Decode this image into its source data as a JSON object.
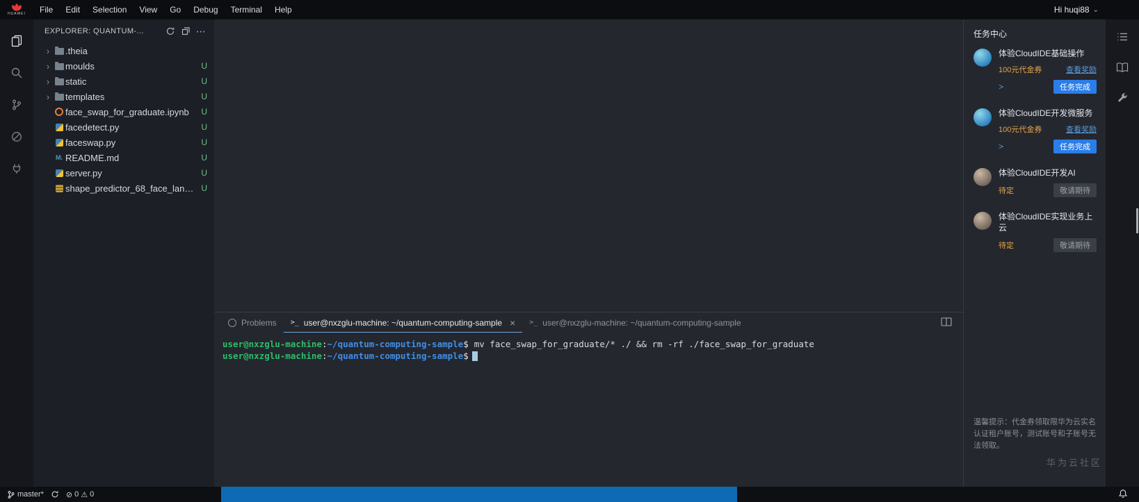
{
  "topbar": {
    "logo_text": "HUAWEI",
    "menus": [
      "File",
      "Edit",
      "Selection",
      "View",
      "Go",
      "Debug",
      "Terminal",
      "Help"
    ],
    "user": "Hi huqi88"
  },
  "icons": {
    "terminal_prompt": ">_",
    "close": "×",
    "more_actions": "⋯",
    "chevron_collapsed": "›",
    "caret_down": "⌄",
    "error_glyph": "⊘",
    "warning_glyph": "⚠",
    "markdown_glyph": "M↓",
    "task_expand": ">"
  },
  "explorer": {
    "title": "EXPLORER: QUANTUM-...",
    "items": [
      {
        "label": ".theia",
        "git": ""
      },
      {
        "label": "moulds",
        "git": "U"
      },
      {
        "label": "static",
        "git": "U"
      },
      {
        "label": "templates",
        "git": "U"
      },
      {
        "label": "face_swap_for_graduate.ipynb",
        "git": "U"
      },
      {
        "label": "facedetect.py",
        "git": "U"
      },
      {
        "label": "faceswap.py",
        "git": "U"
      },
      {
        "label": "README.md",
        "git": "U"
      },
      {
        "label": "server.py",
        "git": "U"
      },
      {
        "label": "shape_predictor_68_face_land...",
        "git": "U"
      }
    ]
  },
  "panel": {
    "tabs": {
      "problems": "Problems",
      "terminal1": "user@nxzglu-machine: ~/quantum-computing-sample",
      "terminal2": "user@nxzglu-machine: ~/quantum-computing-sample"
    },
    "terminal": {
      "user": "user@nxzglu-machine",
      "colon": ":",
      "path": "~/quantum-computing-sample",
      "dollar": "$",
      "command": "mv face_swap_for_graduate/* ./ && rm -rf ./face_swap_for_graduate"
    }
  },
  "task_center": {
    "title": "任务中心",
    "tasks": [
      {
        "title": "体验CloudIDE基础操作",
        "reward": "100元代金券",
        "link": "查看奖励",
        "button": "任务完成"
      },
      {
        "title": "体验CloudIDE开发微服务",
        "reward": "100元代金券",
        "link": "查看奖励",
        "button": "任务完成"
      },
      {
        "title": "体验CloudIDE开发AI",
        "status": "待定",
        "button": "敬请期待"
      },
      {
        "title": "体验CloudIDE实现业务上云",
        "status": "待定",
        "button": "敬请期待"
      }
    ],
    "tip": "温馨提示：代金券领取限华为云实名认证租户账号，测试账号和子账号无法领取。",
    "watermark": "华为云社区"
  },
  "status_bar": {
    "branch": "master*",
    "errors": "0",
    "warnings": "0"
  },
  "colors": {
    "huawei_red": "#e4393c",
    "accent_blue": "#2b7de9",
    "link_blue": "#5a9bdc",
    "reward_orange": "#e8a44a",
    "git_untracked": "#6fc08c",
    "terminal_user_green": "#2dbd69",
    "terminal_path_blue": "#3f8fe8",
    "statusbar_blue": "#0f6ab5"
  }
}
